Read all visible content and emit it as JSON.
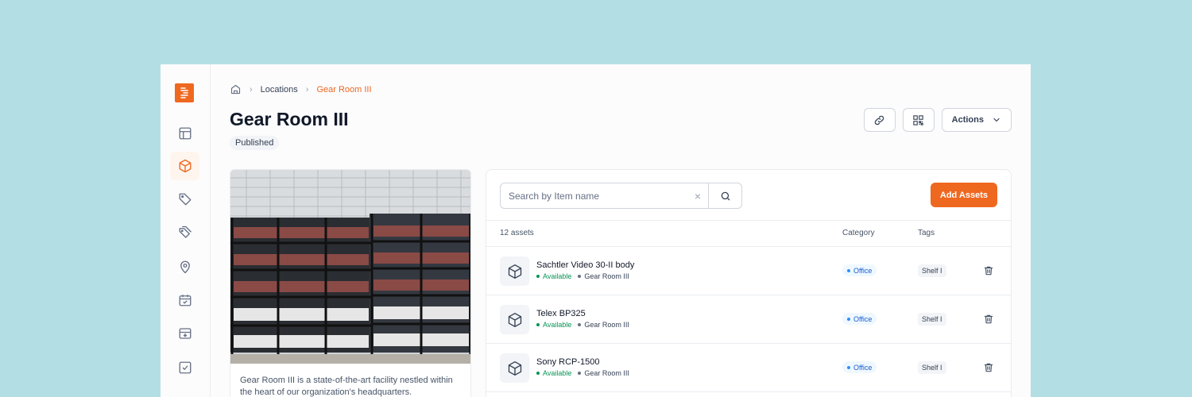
{
  "breadcrumb": {
    "home_icon": "home-icon",
    "items": [
      "Locations",
      "Gear Room III"
    ]
  },
  "page": {
    "title": "Gear Room III",
    "status": "Published"
  },
  "top_actions": {
    "link_icon": "link-icon",
    "qr_icon": "qr-code-icon",
    "actions_label": "Actions"
  },
  "sidebar": {
    "items": [
      {
        "icon": "layout-icon",
        "active": false
      },
      {
        "icon": "cube-icon",
        "active": true
      },
      {
        "icon": "tag-icon",
        "active": false
      },
      {
        "icon": "tags-icon",
        "active": false
      },
      {
        "icon": "location-pin-icon",
        "active": false
      },
      {
        "icon": "calendar-check-icon",
        "active": false
      },
      {
        "icon": "inbox-icon",
        "active": false
      },
      {
        "icon": "checkbox-icon",
        "active": false
      }
    ]
  },
  "location": {
    "description": "Gear Room III is a state-of-the-art facility nestled within the heart of our organization's headquarters."
  },
  "assets": {
    "search_placeholder": "Search by Item name",
    "add_label": "Add Assets",
    "count_label": "12 assets",
    "columns": {
      "category": "Category",
      "tags": "Tags"
    },
    "rows": [
      {
        "name": "Sachtler Video 30-II body",
        "status": "Available",
        "location": "Gear Room III",
        "category": "Office",
        "tag": "Shelf I"
      },
      {
        "name": "Telex BP325",
        "status": "Available",
        "location": "Gear Room III",
        "category": "Office",
        "tag": "Shelf I"
      },
      {
        "name": "Sony RCP-1500",
        "status": "Available",
        "location": "Gear Room III",
        "category": "Office",
        "tag": "Shelf I"
      }
    ]
  },
  "colors": {
    "accent": "#ef6820",
    "available": "#079455",
    "category": "#2e90fa",
    "background": "#b3dfe4"
  }
}
